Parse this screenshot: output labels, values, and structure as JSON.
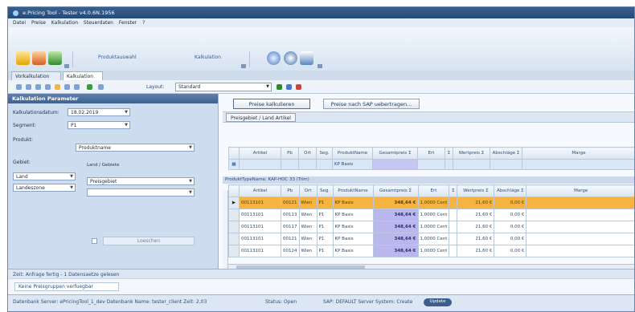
{
  "window": {
    "title": "e.Pricing Tool - Tester v4.0.6N.1956"
  },
  "menu": [
    "Datei",
    "Preise",
    "Kalkulation",
    "Steuerdaten",
    "Fenster",
    "?"
  ],
  "ribbon": {
    "group1": "Produktauswahl",
    "group2": "Kalkulation"
  },
  "colors": {
    "selected_row": "#f7b33f",
    "highlight_column": "#b9b7ee",
    "header": "#3d6190"
  },
  "tabs": [
    "Vorkalkulation",
    "Kalkulation"
  ],
  "toolbar": {
    "layout_label": "Layout:",
    "layout_value": "Standard"
  },
  "params": {
    "title": "Kalkulation Parameter",
    "date_label": "Kalkulationsdatum:",
    "date_value": "18.02.2019",
    "segment_label": "Segment:",
    "segment_value": "P1",
    "product_label": "Produkt:",
    "product_value": "Produktname",
    "group_label": "Gebiet:",
    "region_label": "Land",
    "country_value": "Preisgebiet",
    "row2_label": "Landeszone",
    "note": "Land / Gebiete",
    "action_button": "Loeschen"
  },
  "main": {
    "btn_calc": "Preise kalkulieren",
    "btn_transfer": "Preise nach SAP uebertragen...",
    "filter_chip": "Preisgebiet / Land Artikel",
    "group_text": "ProduktTypeName: KAP-HOC 33 (Trim)",
    "columns": [
      "Artikel",
      "Pb",
      "Ort",
      "Seg.",
      "ProduktName",
      "Gesamtpreis Σ",
      "Ert",
      "Σ",
      "Wertpreis Σ",
      "Abschläge Σ",
      "Marge"
    ],
    "filter_row": {
      "product": "KP Basis"
    },
    "rows": [
      [
        "00113101",
        "00121",
        "Wien",
        "P1",
        "KP Basis",
        "348,64 €",
        "1,0000 Cent",
        "21,60 €",
        "0,00 €"
      ],
      [
        "00113101",
        "00113",
        "Wien",
        "P1",
        "KP Basis",
        "348,64 €",
        "1,0000 Cent",
        "21,60 €",
        "0,00 €"
      ],
      [
        "00113101",
        "00117",
        "Wien",
        "P1",
        "KP Basis",
        "348,64 €",
        "1,0000 Cent",
        "21,60 €",
        "0,00 €"
      ],
      [
        "00113101",
        "00121",
        "Wien",
        "P1",
        "KP Basis",
        "348,64 €",
        "1,0000 Cent",
        "21,60 €",
        "0,00 €"
      ],
      [
        "00113101",
        "00124",
        "Wien",
        "P1",
        "KP Basis",
        "348,64 €",
        "1,0000 Cent",
        "21,60 €",
        "0,00 €"
      ]
    ]
  },
  "info_line": "Zeit: Anfrage fertig - 1 Datensaetze gelesen",
  "info_button": "Keine Preisgruppen verfuegbar",
  "status": {
    "db": "Datenbank Server: ePricingTool_1_dev  Datenbank Name: tester_client  Zeit: 2,03",
    "state": "Status: Open",
    "sap": "SAP: DEFAULT Server System: Create",
    "btn": "Update"
  }
}
